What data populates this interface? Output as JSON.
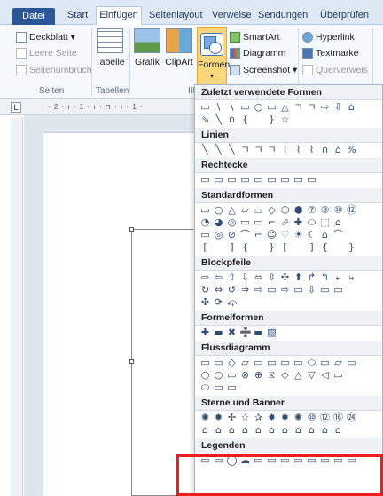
{
  "tabs": {
    "file": "Datei",
    "start": "Start",
    "insert": "Einfügen",
    "layout": "Seitenlayout",
    "references": "Verweise",
    "mailings": "Sendungen",
    "review": "Überprüfen"
  },
  "ribbon": {
    "pages": {
      "cover": "Deckblatt ▾",
      "blank": "Leere Seite",
      "pagebreak": "Seitenumbruch",
      "label": "Seiten"
    },
    "tables": {
      "table": "Tabelle",
      "label": "Tabellen"
    },
    "illustrations": {
      "picture": "Grafik",
      "clipart": "ClipArt",
      "shapes": "Formen",
      "smartart": "SmartArt",
      "chart": "Diagramm",
      "screenshot": "Screenshot ▾",
      "label": "III"
    },
    "links": {
      "hyperlink": "Hyperlink",
      "bookmark": "Textmarke",
      "crossref": "Querverweis"
    }
  },
  "ruler": {
    "corner": "L",
    "scale": "· 2 · ı · 1 · ı · ⊓ · ı · 1 ·"
  },
  "dropdown": {
    "sections": [
      {
        "title": "Zuletzt verwendete Formen",
        "rows": [
          "▭\\\\▭○▭△ㄱㄱ⇨⇩⌂",
          "⇘╲∩{ }☆"
        ]
      },
      {
        "title": "Linien",
        "rows": [
          "╲╲╲ㄱㄱㄱ⌇⌇⌇∩⌂%"
        ]
      },
      {
        "title": "Rechtecke",
        "rows": [
          "▭▭▭▭▭▭▭▭▭"
        ]
      },
      {
        "title": "Standardformen",
        "rows": [
          "▭○△▱⏢◇⬡⬢⑦⑧⑩⑫",
          "◔◕◎▭▭⌐⬀✚⬭⬚⌂",
          "▭◎⊘⌒⌐☺♡☀☾⌂⌒",
          "[ ]{ }[ ]{ }"
        ]
      },
      {
        "title": "Blockpfeile",
        "rows": [
          "⇨⇦⇧⇩⬄⇳✣⬆↱↰⤶⤷",
          "↻⇔↺⇒⇨▭⇨▭⇩▭▭",
          "✣⟳⤽"
        ]
      },
      {
        "title": "Formelformen",
        "rows": [
          "✚▬✖➗▬▨"
        ]
      },
      {
        "title": "Flussdiagramm",
        "rows": [
          "▭▭◇▱▭▭▭▭⬭▭▱▭",
          "○○▭⊗⊕⧖◇△▽◁▭",
          "⬭▭▭"
        ]
      },
      {
        "title": "Sterne und Banner",
        "rows": [
          "✺✹✢☆✰✸✹✺⑩⑫⑯㉔",
          "⌂⌂⌂⌂⌂⌂⌂⌂⌂⌂⌂"
        ]
      },
      {
        "title": "Legenden",
        "rows": [
          "▭▭◯☁▭▭▭▭▭▭▭▭"
        ]
      }
    ]
  },
  "colors": {
    "accent": "#2b579a",
    "highlight_border": "#ee1c1c",
    "active_button": "#fcd67a"
  }
}
